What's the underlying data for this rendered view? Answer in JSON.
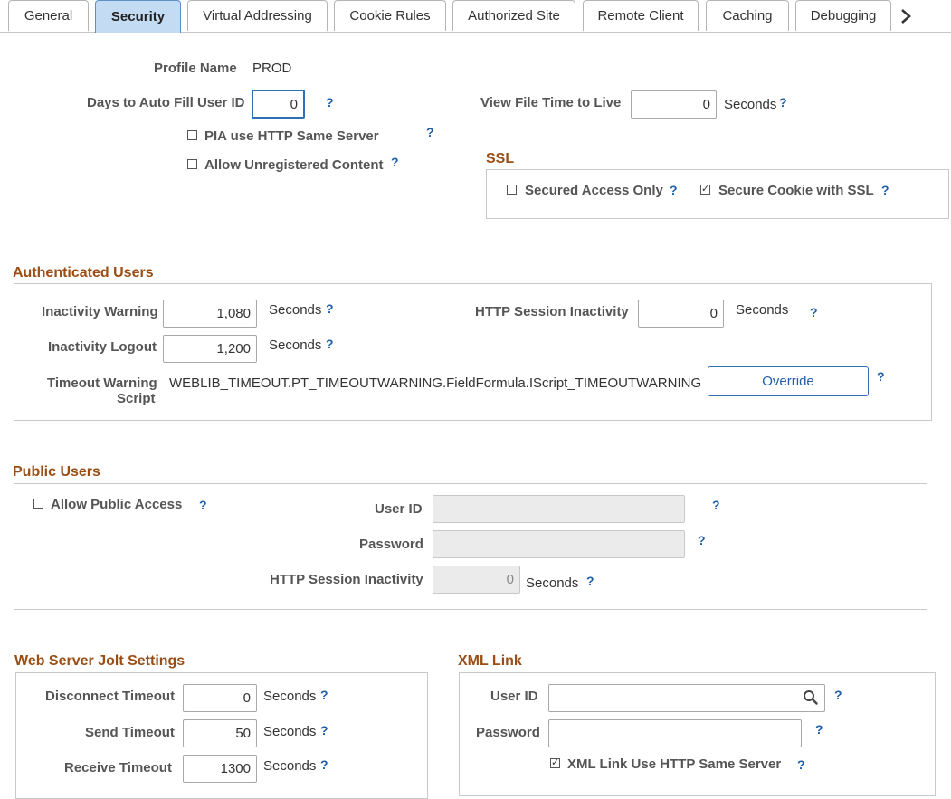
{
  "tabs": [
    "General",
    "Security",
    "Virtual Addressing",
    "Cookie Rules",
    "Authorized Site",
    "Remote Client",
    "Caching",
    "Debugging"
  ],
  "active_tab": "Security",
  "help": "?",
  "general": {
    "profile_name_label": "Profile Name",
    "profile_name_value": "PROD",
    "days_autofill_label": "Days to Auto Fill User ID",
    "days_autofill_value": "0",
    "view_file_ttl_label": "View File Time to Live",
    "view_file_ttl_value": "0",
    "seconds": "Seconds",
    "pia_same_server_label": "PIA use HTTP Same Server",
    "pia_same_server_checked": false,
    "allow_unregistered_label": "Allow Unregistered Content",
    "allow_unregistered_checked": false
  },
  "ssl": {
    "header": "SSL",
    "secured_access_label": "Secured Access Only",
    "secured_access_checked": false,
    "secure_cookie_label": "Secure Cookie with SSL",
    "secure_cookie_checked": true
  },
  "authenticated": {
    "header": "Authenticated Users",
    "inactivity_warning_label": "Inactivity Warning",
    "inactivity_warning_value": "1,080",
    "inactivity_logout_label": "Inactivity Logout",
    "inactivity_logout_value": "1,200",
    "http_session_label": "HTTP Session Inactivity",
    "http_session_value": "0",
    "timeout_script_label_1": "Timeout Warning",
    "timeout_script_label_2": "Script",
    "timeout_script_value": "WEBLIB_TIMEOUT.PT_TIMEOUTWARNING.FieldFormula.IScript_TIMEOUTWARNING",
    "override_button": "Override",
    "seconds": "Seconds"
  },
  "public": {
    "header": "Public Users",
    "allow_public_label": "Allow Public Access",
    "allow_public_checked": false,
    "user_id_label": "User ID",
    "user_id_value": "",
    "password_label": "Password",
    "password_value": "",
    "http_session_label": "HTTP Session Inactivity",
    "http_session_value": "0",
    "seconds": "Seconds"
  },
  "jolt": {
    "header": "Web Server Jolt Settings",
    "disconnect_label": "Disconnect Timeout",
    "disconnect_value": "0",
    "send_label": "Send Timeout",
    "send_value": "50",
    "receive_label": "Receive Timeout",
    "receive_value": "1300",
    "seconds": "Seconds"
  },
  "xml": {
    "header": "XML Link",
    "user_id_label": "User ID",
    "user_id_value": "",
    "password_label": "Password",
    "password_value": "",
    "same_server_label": "XML Link Use HTTP Same Server",
    "same_server_checked": true
  },
  "colors": {
    "section_header": "#9a4e16",
    "active_tab_bg": "#c4dcf3",
    "link_blue": "#1f5fa8"
  }
}
